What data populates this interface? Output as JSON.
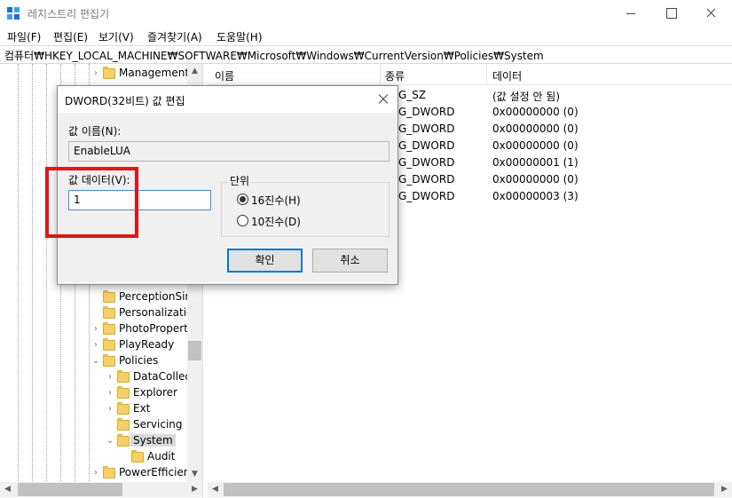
{
  "window": {
    "title": "레지스트리 편집기"
  },
  "menu": [
    {
      "label": "파일(F)"
    },
    {
      "label": "편집(E)"
    },
    {
      "label": "보기(V)"
    },
    {
      "label": "즐겨찾기(A)"
    },
    {
      "label": "도움말(H)"
    }
  ],
  "address": {
    "path": "컴퓨터₩HKEY_LOCAL_MACHINE₩SOFTWARE₩Microsoft₩Windows₩CurrentVersion₩Policies₩System"
  },
  "tree": {
    "items": [
      {
        "label": "Management",
        "expandable": true
      },
      {
        "label": "PerceptionSim",
        "expandable": false
      },
      {
        "label": "Personalization",
        "expandable": false
      },
      {
        "label": "PhotoProperty",
        "expandable": true
      },
      {
        "label": "PlayReady",
        "expandable": true
      },
      {
        "label": "Policies",
        "expandable": true,
        "expanded": true
      },
      {
        "label": "DataCollect",
        "expandable": true
      },
      {
        "label": "Explorer",
        "expandable": true
      },
      {
        "label": "Ext",
        "expandable": true
      },
      {
        "label": "Servicing",
        "expandable": false
      },
      {
        "label": "System",
        "expandable": true,
        "expanded": true,
        "selected": true
      },
      {
        "label": "Audit",
        "expandable": false
      },
      {
        "label": "PowerEfficienc",
        "expandable": true
      }
    ]
  },
  "list": {
    "columns": [
      "이름",
      "종류",
      "데이터"
    ],
    "rows": [
      {
        "type": "G_SZ",
        "data": "(값 설정 안 됨)"
      },
      {
        "type": "G_DWORD",
        "data": "0x00000000 (0)"
      },
      {
        "type": "G_DWORD",
        "data": "0x00000000 (0)"
      },
      {
        "type": "G_DWORD",
        "data": "0x00000000 (0)"
      },
      {
        "type": "G_DWORD",
        "data": "0x00000001 (1)"
      },
      {
        "type": "G_DWORD",
        "data": "0x00000000 (0)"
      },
      {
        "type": "G_DWORD",
        "data": "0x00000003 (3)"
      }
    ]
  },
  "dialog": {
    "title": "DWORD(32비트) 값 편집",
    "value_name_label": "값 이름(N):",
    "value_name": "EnableLUA",
    "value_data_label": "값 데이터(V):",
    "value_data": "1",
    "base_group_label": "단위",
    "radio_hex": "16진수(H)",
    "radio_dec": "10진수(D)",
    "selected_base": "hex",
    "ok_label": "확인",
    "cancel_label": "취소"
  },
  "colors": {
    "accent": "#0078d7",
    "highlight_annotation": "#e31515",
    "folder": "#f5cf6a"
  }
}
